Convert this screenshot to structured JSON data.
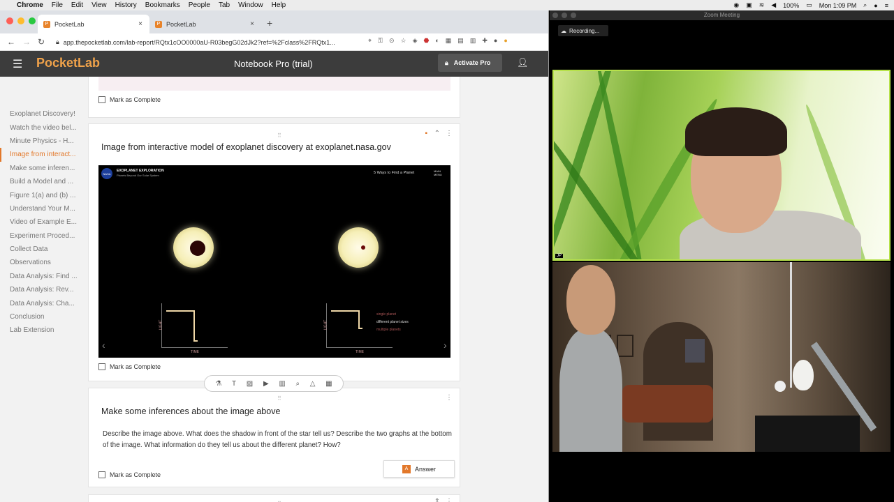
{
  "menubar": {
    "app": "Chrome",
    "items": [
      "File",
      "Edit",
      "View",
      "History",
      "Bookmarks",
      "People",
      "Tab",
      "Window",
      "Help"
    ],
    "battery": "100%",
    "clock": "Mon 1:09 PM"
  },
  "browser": {
    "tabs": [
      {
        "label": "PocketLab",
        "close": "×"
      },
      {
        "label": "PocketLab",
        "close": "×"
      }
    ],
    "new_tab": "+",
    "url": "app.thepocketlab.com/lab-report/RQtx1cOO0000aU-R03begG02dJk2?ref=%2Fclass%2FRQtx1..."
  },
  "header": {
    "logo": "PocketLab",
    "title": "Notebook Pro (trial)",
    "activate": "Activate Pro"
  },
  "toc": [
    "Exoplanet Discovery!",
    "Watch the video bel...",
    "Minute Physics - H...",
    "Image from interact...",
    "Make some inferen...",
    "Build a Model and ...",
    "Figure 1(a) and (b) ...",
    "Understand Your M...",
    "Video of Example E...",
    "Experiment Proced...",
    "Collect Data",
    "Observations",
    "Data Analysis: Find ...",
    "Data Analysis: Rev...",
    "Data Analysis: Cha...",
    "Conclusion",
    "Lab Extension"
  ],
  "toc_active": 3,
  "mark_complete": "Mark as Complete",
  "card_image": {
    "title": "Image from interactive model of exoplanet discovery at exoplanet.nasa.gov",
    "video": {
      "brand": "EXOPLANET EXPLORATION",
      "brand_sub": "Planets Beyond Our Solar System",
      "nasa": "NASA",
      "dropdown": "5 Ways to Find a Planet",
      "main_menu": "MAIN MENU",
      "axis_light": "LIGHT",
      "axis_time": "TIME",
      "legend": [
        "single planet",
        "different planet sizes",
        "multiple planets"
      ],
      "prev": "‹",
      "next": "›"
    }
  },
  "card_inference": {
    "title": "Make some inferences about the image above",
    "body": "Describe the image above. What does the shadow in front of the star tell us? Describe the two graphs at the bottom of the image. What information do they tell us about the different planet? How?",
    "answer": "Answer"
  },
  "zoom": {
    "title": "Zoom Meeting",
    "recording": "Recording...",
    "participant_initials": "JP"
  }
}
